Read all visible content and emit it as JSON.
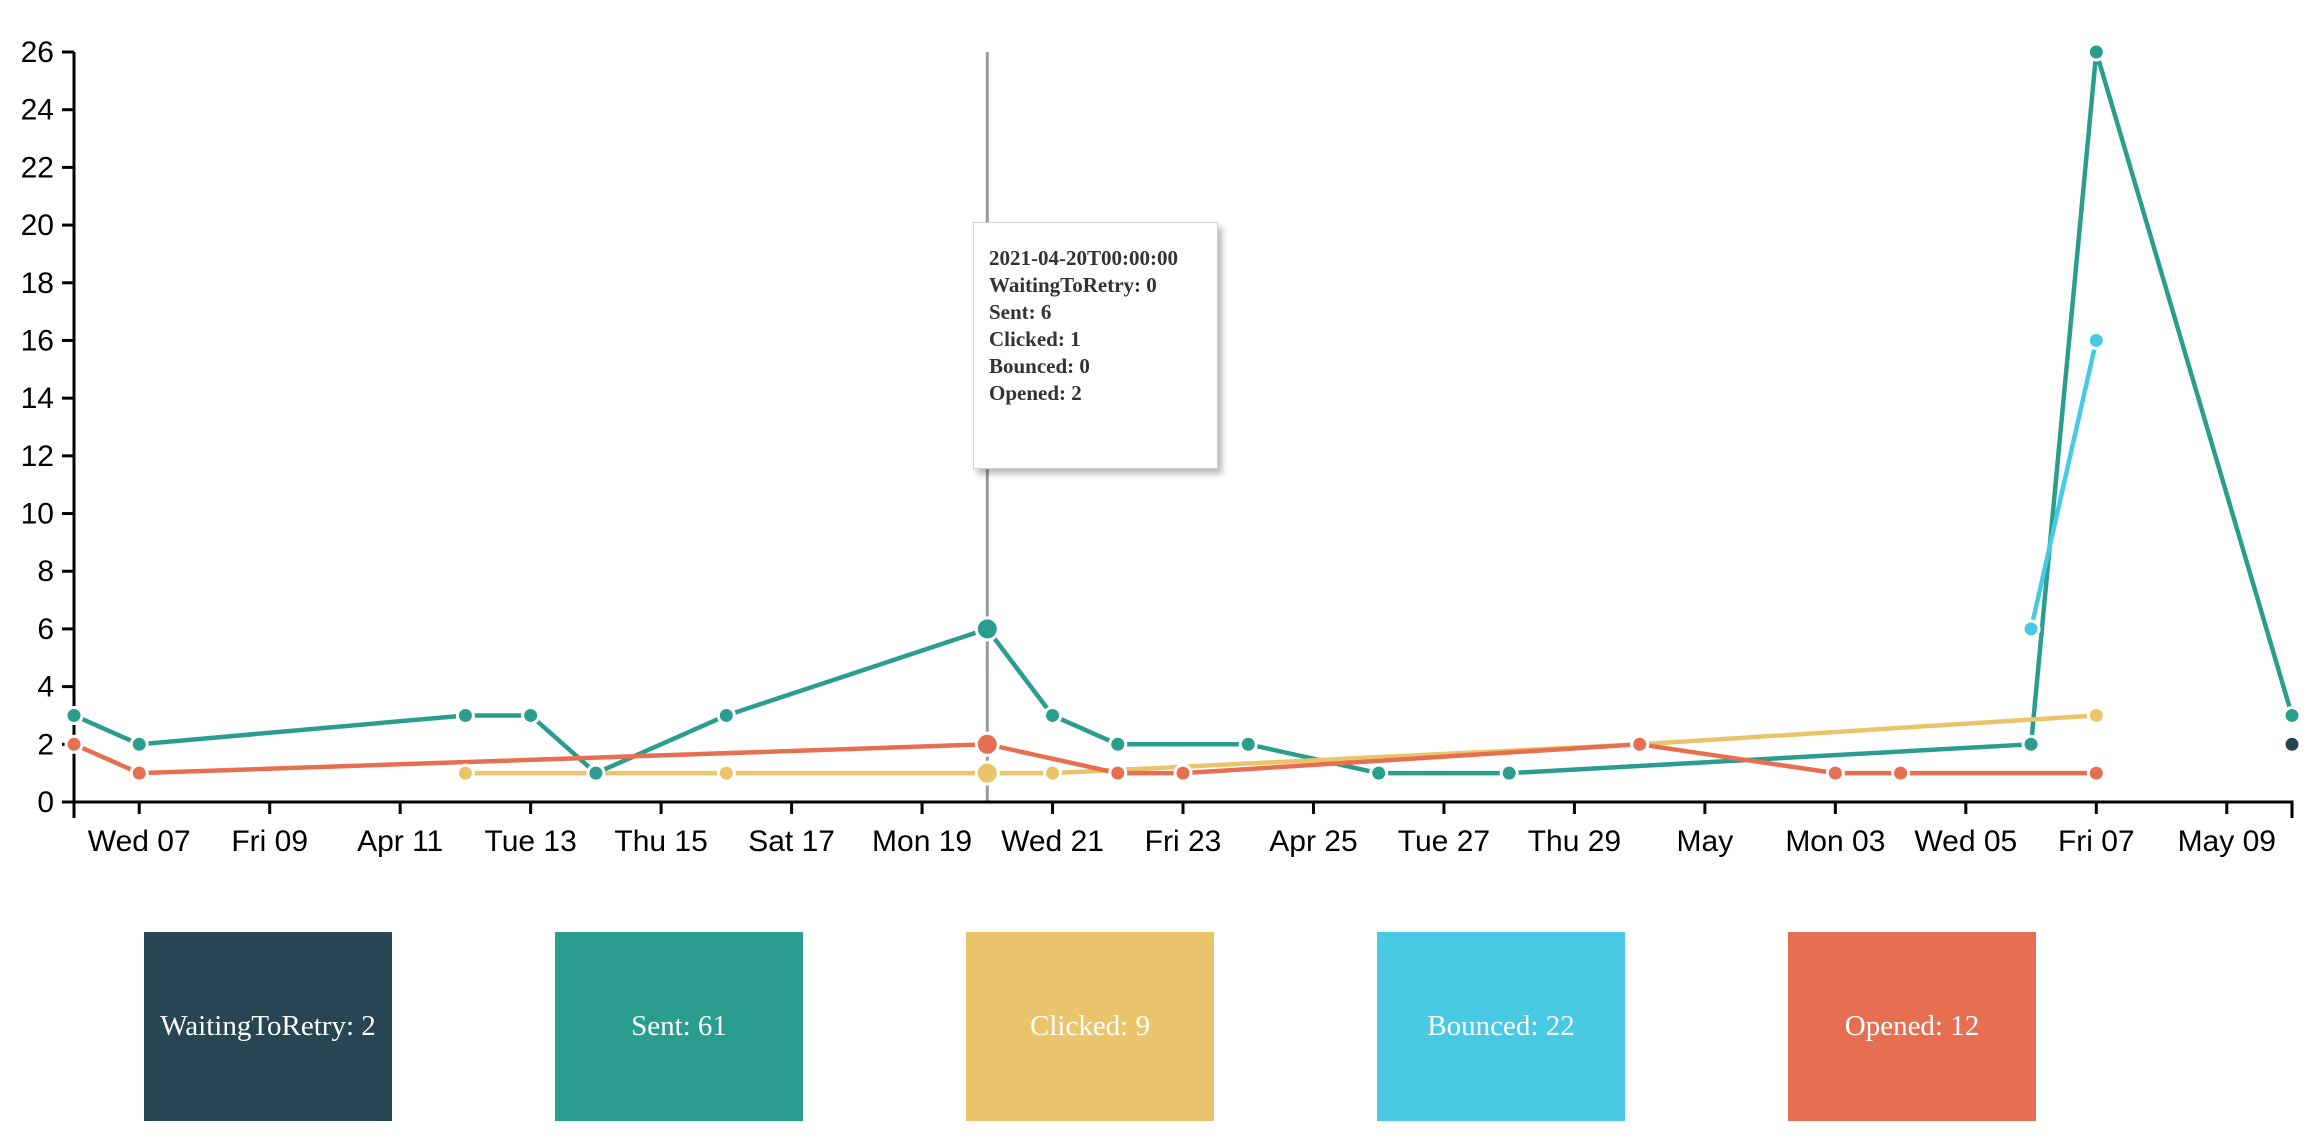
{
  "chart_data": {
    "type": "line",
    "x_start": "2021-04-06",
    "x_end": "2021-05-10",
    "ylim": [
      0,
      26
    ],
    "y_ticks": [
      0,
      2,
      4,
      6,
      8,
      10,
      12,
      14,
      16,
      18,
      20,
      22,
      24,
      26
    ],
    "x_ticks": [
      {
        "date": "2021-04-07",
        "label": "Wed 07"
      },
      {
        "date": "2021-04-09",
        "label": "Fri 09"
      },
      {
        "date": "2021-04-11",
        "label": "Apr 11"
      },
      {
        "date": "2021-04-13",
        "label": "Tue 13"
      },
      {
        "date": "2021-04-15",
        "label": "Thu 15"
      },
      {
        "date": "2021-04-17",
        "label": "Sat 17"
      },
      {
        "date": "2021-04-19",
        "label": "Mon 19"
      },
      {
        "date": "2021-04-21",
        "label": "Wed 21"
      },
      {
        "date": "2021-04-23",
        "label": "Fri 23"
      },
      {
        "date": "2021-04-25",
        "label": "Apr 25"
      },
      {
        "date": "2021-04-27",
        "label": "Tue 27"
      },
      {
        "date": "2021-04-29",
        "label": "Thu 29"
      },
      {
        "date": "2021-05-01",
        "label": "May"
      },
      {
        "date": "2021-05-03",
        "label": "Mon 03"
      },
      {
        "date": "2021-05-05",
        "label": "Wed 05"
      },
      {
        "date": "2021-05-07",
        "label": "Fri 07"
      },
      {
        "date": "2021-05-09",
        "label": "May 09"
      }
    ],
    "highlight_date": "2021-04-20",
    "series": [
      {
        "name": "WaitingToRetry",
        "color": "#264653",
        "points": [
          {
            "x": "2021-05-10",
            "y": 2
          }
        ]
      },
      {
        "name": "Sent",
        "color": "#2a9d8f",
        "points": [
          {
            "x": "2021-04-06",
            "y": 3
          },
          {
            "x": "2021-04-07",
            "y": 2
          },
          {
            "x": "2021-04-12",
            "y": 3
          },
          {
            "x": "2021-04-13",
            "y": 3
          },
          {
            "x": "2021-04-14",
            "y": 1
          },
          {
            "x": "2021-04-16",
            "y": 3
          },
          {
            "x": "2021-04-20",
            "y": 6
          },
          {
            "x": "2021-04-21",
            "y": 3
          },
          {
            "x": "2021-04-22",
            "y": 2
          },
          {
            "x": "2021-04-24",
            "y": 2
          },
          {
            "x": "2021-04-26",
            "y": 1
          },
          {
            "x": "2021-04-28",
            "y": 1
          },
          {
            "x": "2021-05-06",
            "y": 2
          },
          {
            "x": "2021-05-07",
            "y": 26
          },
          {
            "x": "2021-05-10",
            "y": 3
          }
        ]
      },
      {
        "name": "Clicked",
        "color": "#e9c46a",
        "points": [
          {
            "x": "2021-04-12",
            "y": 1
          },
          {
            "x": "2021-04-16",
            "y": 1
          },
          {
            "x": "2021-04-20",
            "y": 1
          },
          {
            "x": "2021-04-21",
            "y": 1
          },
          {
            "x": "2021-04-30",
            "y": 2
          },
          {
            "x": "2021-05-07",
            "y": 3
          }
        ]
      },
      {
        "name": "Bounced",
        "color": "#48cae4",
        "points": [
          {
            "x": "2021-05-06",
            "y": 6
          },
          {
            "x": "2021-05-07",
            "y": 16
          }
        ]
      },
      {
        "name": "Opened",
        "color": "#e76f51",
        "points": [
          {
            "x": "2021-04-06",
            "y": 2
          },
          {
            "x": "2021-04-07",
            "y": 1
          },
          {
            "x": "2021-04-20",
            "y": 2
          },
          {
            "x": "2021-04-22",
            "y": 1
          },
          {
            "x": "2021-04-23",
            "y": 1
          },
          {
            "x": "2021-04-30",
            "y": 2
          },
          {
            "x": "2021-05-03",
            "y": 1
          },
          {
            "x": "2021-05-04",
            "y": 1
          },
          {
            "x": "2021-05-07",
            "y": 1
          }
        ]
      }
    ]
  },
  "tooltip": {
    "date": "2021-04-20T00:00:00",
    "lines": [
      "WaitingToRetry: 0",
      "Sent: 6",
      "Clicked: 1",
      "Bounced: 0",
      "Opened: 2"
    ]
  },
  "legend": [
    {
      "label": "WaitingToRetry: 2",
      "color": "#264653"
    },
    {
      "label": "Sent: 61",
      "color": "#2a9d8f"
    },
    {
      "label": "Clicked: 9",
      "color": "#e9c46a"
    },
    {
      "label": "Bounced: 22",
      "color": "#48cae4"
    },
    {
      "label": "Opened: 12",
      "color": "#e76f51"
    }
  ]
}
